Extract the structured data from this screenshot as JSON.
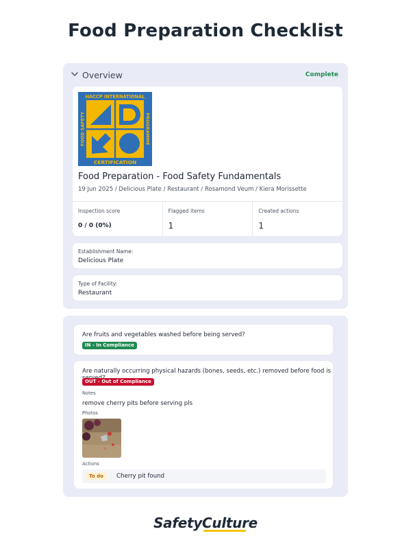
{
  "page": {
    "title": "Food Preparation Checklist"
  },
  "overview": {
    "title": "Overview",
    "status": "Complete",
    "logo_text_top": "HACCP INTERNATIONAL",
    "logo_text_bottom": "CERTIFICATION",
    "logo_text_left": "FOOD SAFETY",
    "logo_text_right": "PROGRAMME",
    "inspection_title": "Food Preparation - Food Safety Fundamentals",
    "meta": "19 Jun 2025 / Delicious Plate / Restaurant / Rosamond Veum / Kiera Morissette",
    "stats": [
      {
        "label": "Inspection score",
        "value": "0 / 0 (0%)"
      },
      {
        "label": "Flagged items",
        "value": "1"
      },
      {
        "label": "Created actions",
        "value": "1"
      }
    ],
    "fields": [
      {
        "label": "Establishment Name:",
        "value": "Delicious Plate"
      },
      {
        "label": "Type of Facility:",
        "value": "Restaurant"
      }
    ]
  },
  "questions": [
    {
      "text": "Are fruits and vegetables washed before being served?",
      "badge": "IN - In Compliance"
    },
    {
      "text": "Are naturally occurring physical hazards (bones, seeds, etc.) removed before food is served?",
      "badge": "OUT - Out of Compliance",
      "notes_label": "Notes",
      "notes": "remove cherry pits before serving pls",
      "photos_label": "Photos",
      "actions_label": "Actions",
      "action_status": "To do",
      "action_text": "Cherry pit found"
    }
  ],
  "brand": {
    "name": "SafetyCulture"
  },
  "colors": {
    "in_compliance": "#1f8a52",
    "out_compliance": "#c8102e",
    "logo_blue": "#2f6fb5",
    "logo_yellow": "#f5b800"
  }
}
